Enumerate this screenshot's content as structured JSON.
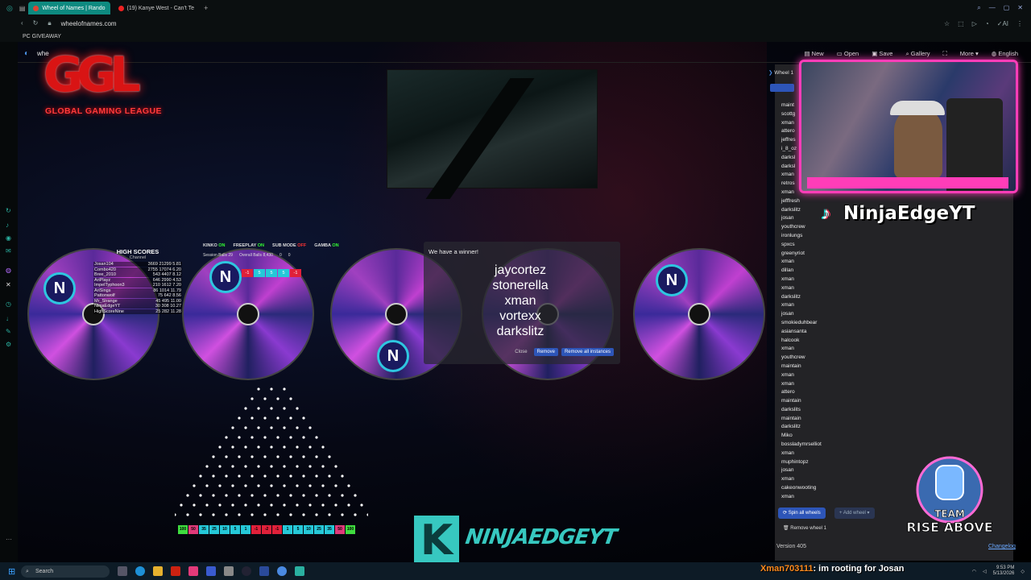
{
  "browser": {
    "tabs": [
      {
        "label": "Wheel of Names | Rando",
        "active": true,
        "fav_color": "#d43"
      },
      {
        "label": "(19) Kanye West - Can't Te",
        "active": false,
        "fav_color": "#e22"
      }
    ],
    "new_tab": "+",
    "url": "wheelofnames.com",
    "bookmark": "PC GIVEAWAY"
  },
  "toolbar": {
    "site_name": "whe",
    "menu": [
      "New",
      "Open",
      "Save",
      "Gallery",
      "More",
      "English"
    ]
  },
  "ggl": {
    "letters": "GGL",
    "subtitle": "GLOBAL GAMING LEAGUE"
  },
  "high_scores": {
    "title": "HIGH SCORES",
    "channel": "Channel",
    "rows": [
      {
        "name": "Josan104",
        "a": "3669",
        "b": "21299",
        "c": "5.81"
      },
      {
        "name": "Combo420",
        "a": "2755",
        "b": "17074",
        "c": "6.20"
      },
      {
        "name": "Bree_2010",
        "a": "543",
        "b": "4407",
        "c": "8.12"
      },
      {
        "name": "AriPlayz",
        "a": "646",
        "b": "2990",
        "c": "4.53"
      },
      {
        "name": "ImpelTyphoon3",
        "a": "210",
        "b": "1612",
        "c": "7.20"
      },
      {
        "name": "AriSings",
        "a": "86",
        "b": "1014",
        "c": "11.79"
      },
      {
        "name": "Pattonwolf",
        "a": "75",
        "b": "642",
        "c": "8.56"
      },
      {
        "name": "Mr_Strange",
        "a": "45",
        "b": "495",
        "c": "11.00"
      },
      {
        "name": "NinjaEdgeYT",
        "a": "30",
        "b": "308",
        "c": "10.27"
      },
      {
        "name": "HighScoreNine",
        "a": "25",
        "b": "282",
        "c": "11.28"
      }
    ]
  },
  "plinko": {
    "kinko": "KINKO",
    "kinko_state": "ON",
    "freeplay": "FREEPLAY",
    "freeplay_state": "ON",
    "submode": "SUB MODE",
    "submode_state": "OFF",
    "gamba": "GAMBA",
    "gamba_state": "ON",
    "session_balls_label": "Session Balls",
    "session_balls": "29",
    "overall_balls_label": "Overall Balls",
    "overall_balls": "8,430",
    "extra_a": "0",
    "extra_b": "0",
    "mini_slots": [
      "-1",
      "5",
      "5",
      "5",
      "-1"
    ],
    "slots": [
      "100",
      "50",
      "35",
      "25",
      "10",
      "5",
      "1",
      "-1",
      "-2",
      "-1",
      "1",
      "5",
      "10",
      "25",
      "35",
      "50",
      "100"
    ]
  },
  "winner": {
    "heading": "We have a winner!",
    "names": [
      "jaycortez",
      "stonerella",
      "xman",
      "vortexx",
      "darkslitz"
    ],
    "close": "Close",
    "remove": "Remove",
    "remove_all": "Remove all instances"
  },
  "right_panel": {
    "wheel_label": "Wheel 1",
    "entries": [
      "maint",
      "scottg",
      "xman",
      "attero",
      "jeffres",
      "i_8_oz",
      "darksl",
      "darksl",
      "xman",
      "retros",
      "xman",
      "jefffresh",
      "darkslitz",
      "josan",
      "youthcrew",
      "ironlungs",
      "spxcs",
      "greenyriot",
      "xman",
      "dillan",
      "xman",
      "xman",
      "darkslitz",
      "xman",
      "josan",
      "smokieduhbear",
      "asiansanta",
      "halcook",
      "xman",
      "youthcrew",
      "maintain",
      "xman",
      "xman",
      "attero",
      "maintain",
      "darkslits",
      "maintain",
      "darkslitz",
      "Miko",
      "bossladymrselliot",
      "xman",
      "muphintopz",
      "josan",
      "xman",
      "cakeonwooting",
      "xman"
    ],
    "spin_all": "Spin all wheels",
    "add_wheel": "Add wheel",
    "remove_wheel": "Remove wheel 1",
    "version": "Version 405",
    "changelog": "Changelog"
  },
  "stream": {
    "tiktok_name": "NinjaEdgeYT",
    "k_letter": "K",
    "ninja_logo": "NINJAEDGEYT",
    "team_line1": "TEAM",
    "team_line2": "RISE ABOVE"
  },
  "taskbar": {
    "search_placeholder": "Search",
    "chat_user": "Xman703111",
    "chat_message": ": im rooting for Josan",
    "time": "9:53 PM",
    "date": "5/13/2026"
  },
  "colors": {
    "accent_teal": "#0e8a80",
    "ggl_red": "#d91414",
    "cam_border": "#ff3db8",
    "button_blue": "#2d55b8"
  }
}
